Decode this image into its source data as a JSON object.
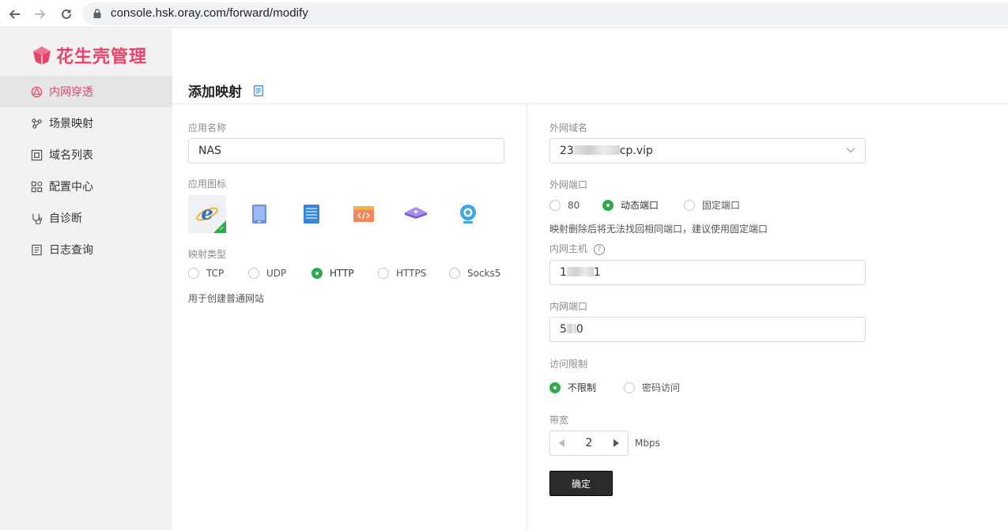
{
  "browser": {
    "url": "console.hsk.oray.com/forward/modify"
  },
  "brand": {
    "name": "花生壳管理",
    "accent": "#e8436a"
  },
  "sidebar": {
    "items": [
      {
        "label": "内网穿透",
        "icon": "penetration-icon",
        "active": true
      },
      {
        "label": "场景映射",
        "icon": "scene-map-icon",
        "active": false
      },
      {
        "label": "域名列表",
        "icon": "domain-list-icon",
        "active": false
      },
      {
        "label": "配置中心",
        "icon": "config-grid-icon",
        "active": false
      },
      {
        "label": "自诊断",
        "icon": "diagnose-icon",
        "active": false
      },
      {
        "label": "日志查询",
        "icon": "log-icon",
        "active": false
      }
    ]
  },
  "page": {
    "title": "添加映射"
  },
  "form_left": {
    "app_name_label": "应用名称",
    "app_name_value": "NAS",
    "app_icon_label": "应用图标",
    "app_icons": [
      "ie-icon",
      "tablet-icon",
      "server-icon",
      "code-window-icon",
      "layers-icon",
      "webcam-icon"
    ],
    "selected_icon": "ie-icon",
    "mapping_type_label": "映射类型",
    "mapping_types": [
      "TCP",
      "UDP",
      "HTTP",
      "HTTPS",
      "Socks5"
    ],
    "mapping_type_selected": "HTTP",
    "mapping_hint": "用于创建普通网站"
  },
  "form_right": {
    "domain_label": "外网域名",
    "domain_value_prefix": "23",
    "domain_value_suffix": "cp.vip",
    "port_label": "外网端口",
    "port_options": [
      "80",
      "动态端口",
      "固定端口"
    ],
    "port_selected": "动态端口",
    "port_hint": "映射删除后将无法找回相同端口，建议使用固定端口",
    "host_label": "内网主机",
    "host_value_prefix": "1",
    "host_value_suffix": "1",
    "inner_port_label": "内网端口",
    "inner_port_prefix": "5",
    "inner_port_suffix": "0",
    "access_label": "访问限制",
    "access_options": [
      "不限制",
      "密码访问"
    ],
    "access_selected": "不限制",
    "bandwidth_label": "带宽",
    "bandwidth_value": "2",
    "bandwidth_unit": "Mbps",
    "submit_label": "确定"
  },
  "colors": {
    "radio_checked": "#2eab4b",
    "button_dark": "#2b2b2b"
  }
}
